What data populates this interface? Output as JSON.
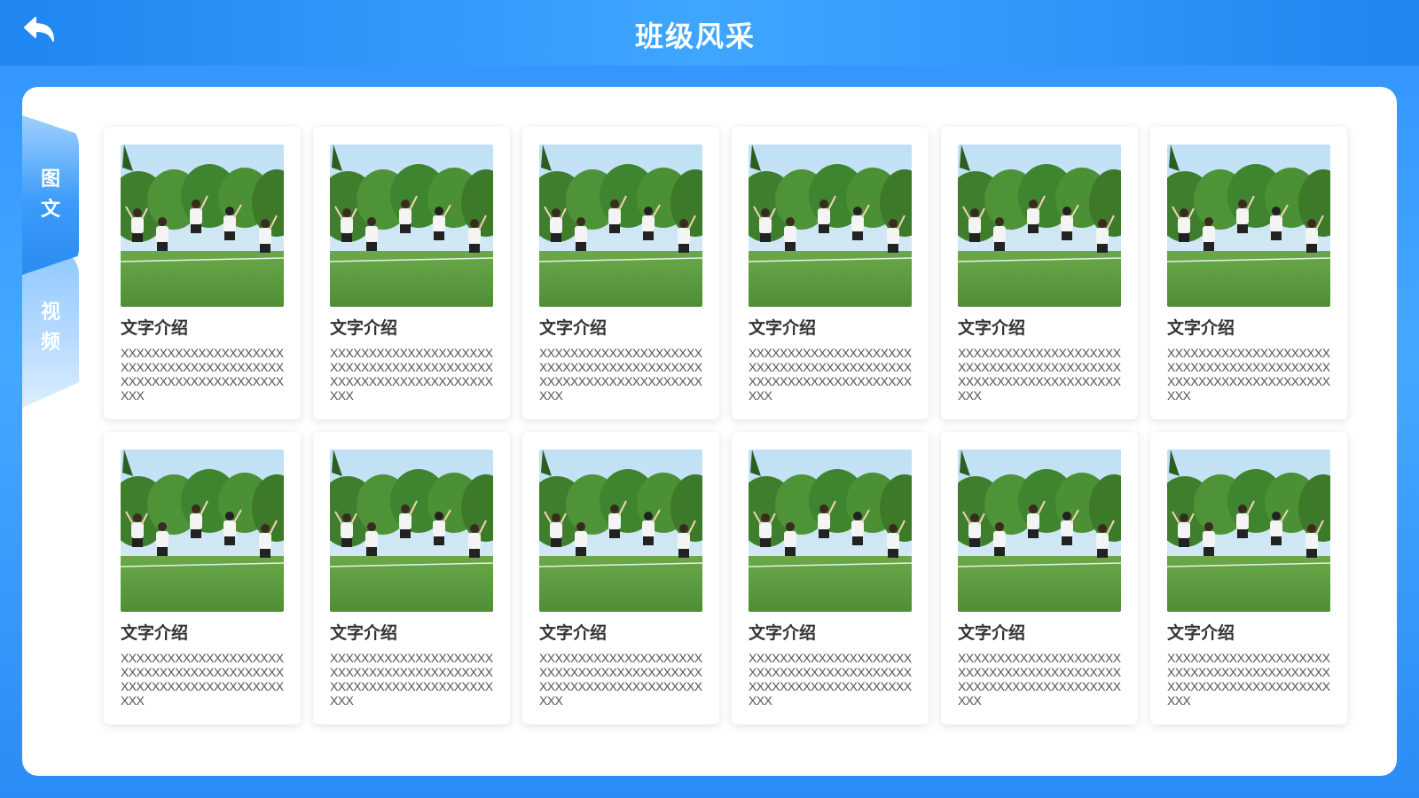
{
  "header": {
    "title": "班级风采",
    "back_icon": "back-arrow-icon"
  },
  "sidebar": {
    "tabs": [
      {
        "label_line1": "图",
        "label_line2": "文",
        "active": true
      },
      {
        "label_line1": "视",
        "label_line2": "频",
        "active": false
      }
    ]
  },
  "cards": [
    {
      "title": "文字介绍",
      "desc": "XXXXXXXXXXXXXXXXXXXXXXXXXXXXXXXXXXXXXXXXXXXXXXXXXXXXXXXXXXXXXXXXXX"
    },
    {
      "title": "文字介绍",
      "desc": "XXXXXXXXXXXXXXXXXXXXXXXXXXXXXXXXXXXXXXXXXXXXXXXXXXXXXXXXXXXXXXXXXX"
    },
    {
      "title": "文字介绍",
      "desc": "XXXXXXXXXXXXXXXXXXXXXXXXXXXXXXXXXXXXXXXXXXXXXXXXXXXXXXXXXXXXXXXXXX"
    },
    {
      "title": "文字介绍",
      "desc": "XXXXXXXXXXXXXXXXXXXXXXXXXXXXXXXXXXXXXXXXXXXXXXXXXXXXXXXXXXXXXXXXXX"
    },
    {
      "title": "文字介绍",
      "desc": "XXXXXXXXXXXXXXXXXXXXXXXXXXXXXXXXXXXXXXXXXXXXXXXXXXXXXXXXXXXXXXXXXX"
    },
    {
      "title": "文字介绍",
      "desc": "XXXXXXXXXXXXXXXXXXXXXXXXXXXXXXXXXXXXXXXXXXXXXXXXXXXXXXXXXXXXXXXXXX"
    },
    {
      "title": "文字介绍",
      "desc": "XXXXXXXXXXXXXXXXXXXXXXXXXXXXXXXXXXXXXXXXXXXXXXXXXXXXXXXXXXXXXXXXXX"
    },
    {
      "title": "文字介绍",
      "desc": "XXXXXXXXXXXXXXXXXXXXXXXXXXXXXXXXXXXXXXXXXXXXXXXXXXXXXXXXXXXXXXXXXX"
    },
    {
      "title": "文字介绍",
      "desc": "XXXXXXXXXXXXXXXXXXXXXXXXXXXXXXXXXXXXXXXXXXXXXXXXXXXXXXXXXXXXXXXXXX"
    },
    {
      "title": "文字介绍",
      "desc": "XXXXXXXXXXXXXXXXXXXXXXXXXXXXXXXXXXXXXXXXXXXXXXXXXXXXXXXXXXXXXXXXXX"
    },
    {
      "title": "文字介绍",
      "desc": "XXXXXXXXXXXXXXXXXXXXXXXXXXXXXXXXXXXXXXXXXXXXXXXXXXXXXXXXXXXXXXXXXX"
    },
    {
      "title": "文字介绍",
      "desc": "XXXXXXXXXXXXXXXXXXXXXXXXXXXXXXXXXXXXXXXXXXXXXXXXXXXXXXXXXXXXXXXXXX"
    }
  ],
  "colors": {
    "brand_blue": "#2f93ff",
    "panel_bg": "#ffffff",
    "title_text": "#333333",
    "desc_text": "#555555"
  }
}
